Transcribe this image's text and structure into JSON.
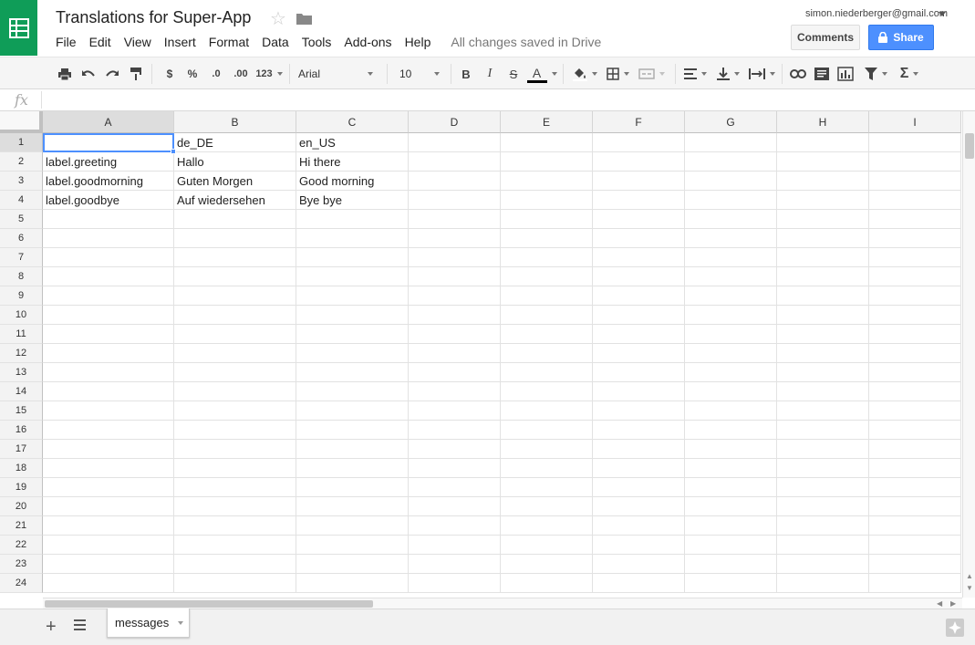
{
  "document": {
    "title": "Translations for Super-App",
    "save_status": "All changes saved in Drive",
    "account_email": "simon.niederberger@gmail.com",
    "brand_color": "#0f9d58"
  },
  "menu": [
    "File",
    "Edit",
    "View",
    "Insert",
    "Format",
    "Data",
    "Tools",
    "Add-ons",
    "Help"
  ],
  "buttons": {
    "comments": "Comments",
    "share": "Share"
  },
  "toolbar": {
    "currency": "$",
    "percent": "%",
    "decrease_decimal": ".0",
    "increase_decimal": ".00",
    "more_formats": "123",
    "font": "Arial",
    "font_size": "10",
    "bold": "B",
    "italic": "I",
    "strikethrough": "S",
    "text_color": "A",
    "function": "Σ"
  },
  "formula_bar": {
    "fx": "fx",
    "value": ""
  },
  "grid": {
    "columns": [
      "A",
      "B",
      "C",
      "D",
      "E",
      "F",
      "G",
      "H",
      "I"
    ],
    "selected_column": "A",
    "selected_row": "1",
    "rows": [
      "1",
      "2",
      "3",
      "4",
      "5",
      "6",
      "7",
      "8",
      "9",
      "10",
      "11",
      "12",
      "13",
      "14",
      "15",
      "16",
      "17",
      "18",
      "19",
      "20",
      "21",
      "22",
      "23",
      "24"
    ],
    "cells": [
      [
        "",
        "de_DE",
        "en_US"
      ],
      [
        "label.greeting",
        "Hallo",
        "Hi there"
      ],
      [
        "label.goodmorning",
        "Guten Morgen",
        "Good morning"
      ],
      [
        "label.goodbye",
        "Auf wiedersehen",
        "Bye bye"
      ]
    ]
  },
  "sheets": {
    "tabs": [
      "messages"
    ],
    "active": "messages"
  }
}
